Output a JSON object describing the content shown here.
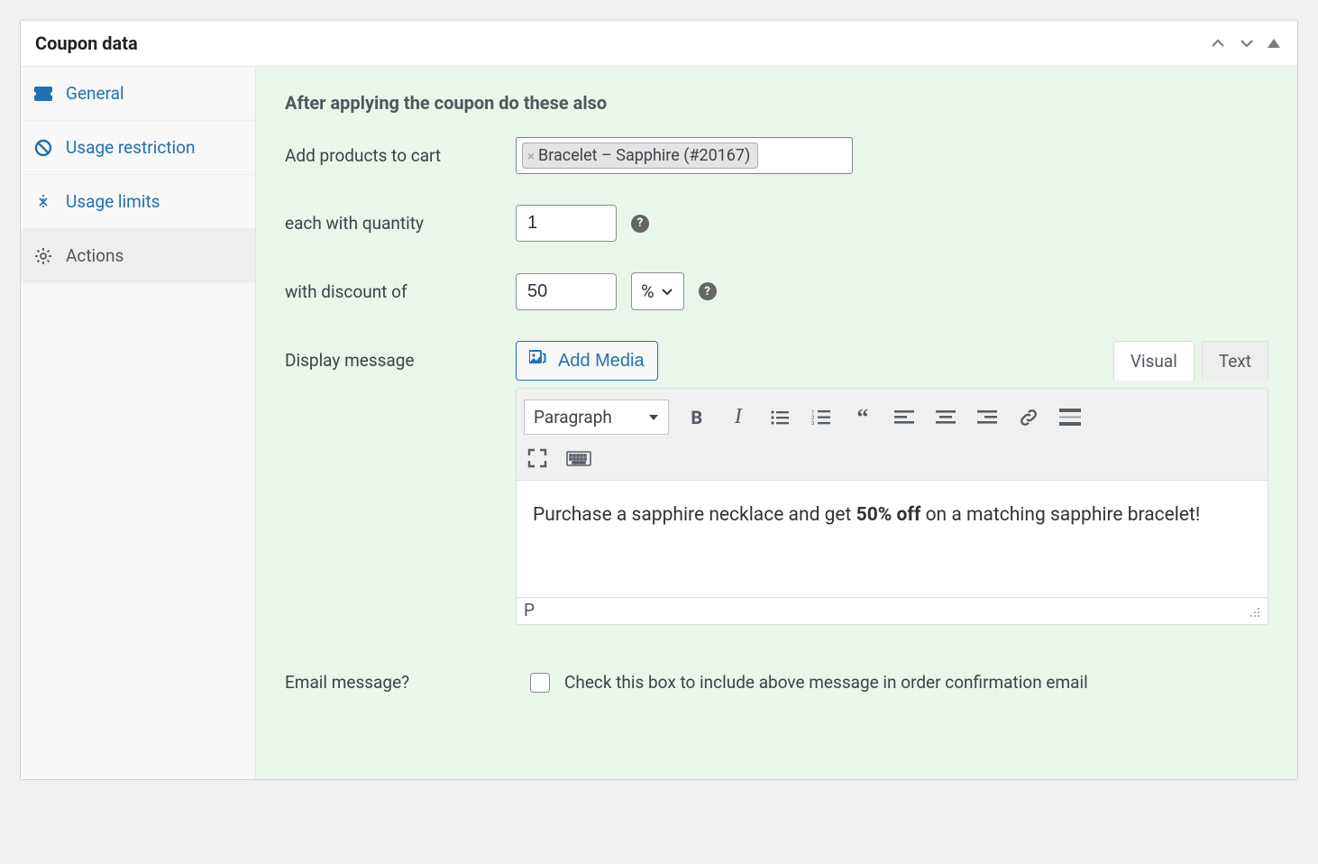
{
  "panel": {
    "title": "Coupon data"
  },
  "sidebar": {
    "items": [
      {
        "label": "General"
      },
      {
        "label": "Usage restriction"
      },
      {
        "label": "Usage limits"
      },
      {
        "label": "Actions"
      }
    ]
  },
  "content": {
    "section_title": "After applying the coupon do these also",
    "add_products_label": "Add products to cart",
    "product_chip": "Bracelet – Sapphire (#20167)",
    "quantity_label": "each with quantity",
    "quantity_value": "1",
    "discount_label": "with discount of",
    "discount_value": "50",
    "discount_unit": "%",
    "display_message_label": "Display message",
    "add_media_label": "Add Media",
    "tab_visual": "Visual",
    "tab_text": "Text",
    "format_select": "Paragraph",
    "editor_text_pre": "Purchase a sapphire necklace and get ",
    "editor_text_bold": "50% off",
    "editor_text_post": " on a matching sapphire bracelet!",
    "status_path": "P",
    "email_label": "Email message?",
    "email_desc": "Check this box to include above message in order confirmation email"
  }
}
